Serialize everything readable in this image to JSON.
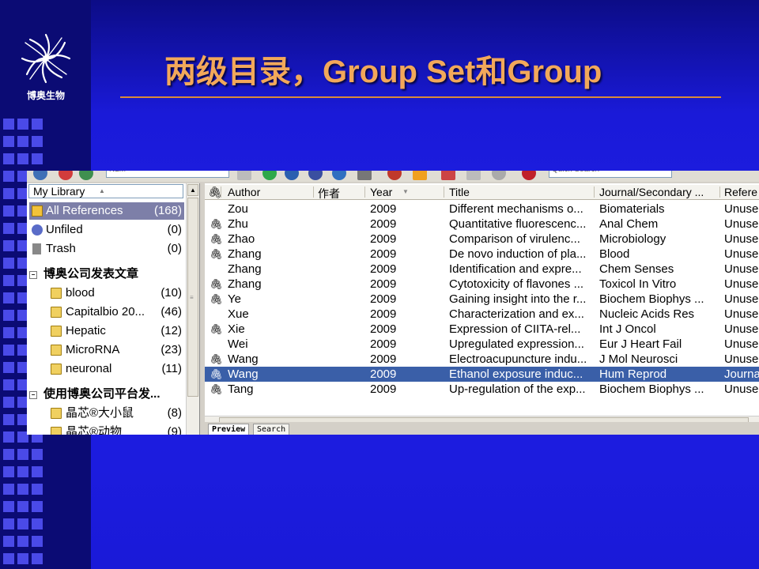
{
  "slide": {
    "title": "两级目录，Group Set和Group",
    "logo_text": "博奥生物",
    "colors": {
      "background": "#1f1fe8",
      "title": "#f2a85a",
      "rule": "#d98a3a"
    }
  },
  "toolbar": {
    "style_field": "NLM",
    "search_field": "Quick Search"
  },
  "library": {
    "header": "My Library",
    "items": [
      {
        "label": "All References",
        "count": "(168)",
        "icon": "references-icon",
        "selected": true
      },
      {
        "label": "Unfiled",
        "count": "(0)",
        "icon": "unfiled-icon"
      },
      {
        "label": "Trash",
        "count": "(0)",
        "icon": "trash-icon"
      }
    ],
    "group_sets": [
      {
        "label": "博奥公司发表文章",
        "groups": [
          {
            "label": "blood",
            "count": "(10)"
          },
          {
            "label": "Capitalbio 20...",
            "count": "(46)"
          },
          {
            "label": "Hepatic",
            "count": "(12)"
          },
          {
            "label": "MicroRNA",
            "count": "(23)"
          },
          {
            "label": "neuronal",
            "count": "(11)"
          }
        ]
      },
      {
        "label": "使用博奥公司平台发...",
        "groups": [
          {
            "label": "晶芯®大小鼠",
            "count": "(8)"
          },
          {
            "label": "晶芯®动物",
            "count": "(9)"
          }
        ]
      }
    ]
  },
  "references": {
    "columns": [
      "Author",
      "作者",
      "Year",
      "Title",
      "Journal/Secondary ...",
      "Refere"
    ],
    "rows": [
      {
        "clip": "",
        "author": "Zou",
        "year": "2009",
        "title": "Different mechanisms o...",
        "journal": "Biomaterials",
        "ref": "Unuse"
      },
      {
        "clip": "clip",
        "author": "Zhu",
        "year": "2009",
        "title": "Quantitative fluorescenc...",
        "journal": "Anal Chem",
        "ref": "Unuse"
      },
      {
        "clip": "clip",
        "author": "Zhao",
        "year": "2009",
        "title": "Comparison of virulenc...",
        "journal": "Microbiology",
        "ref": "Unuse"
      },
      {
        "clip": "clip",
        "author": "Zhang",
        "year": "2009",
        "title": "De novo induction of pla...",
        "journal": "Blood",
        "ref": "Unuse"
      },
      {
        "clip": "",
        "author": "Zhang",
        "year": "2009",
        "title": "Identification and expre...",
        "journal": "Chem Senses",
        "ref": "Unuse"
      },
      {
        "clip": "clip",
        "author": "Zhang",
        "year": "2009",
        "title": "Cytotoxicity of flavones ...",
        "journal": "Toxicol In Vitro",
        "ref": "Unuse"
      },
      {
        "clip": "clip",
        "author": "Ye",
        "year": "2009",
        "title": "Gaining insight into the r...",
        "journal": "Biochem Biophys ...",
        "ref": "Unuse"
      },
      {
        "clip": "",
        "author": "Xue",
        "year": "2009",
        "title": "Characterization and ex...",
        "journal": "Nucleic Acids Res",
        "ref": "Unuse"
      },
      {
        "clip": "clip",
        "author": "Xie",
        "year": "2009",
        "title": "Expression of CIITA-rel...",
        "journal": "Int J Oncol",
        "ref": "Unuse"
      },
      {
        "clip": "",
        "author": "Wei",
        "year": "2009",
        "title": "Upregulated expression...",
        "journal": "Eur J Heart Fail",
        "ref": "Unuse"
      },
      {
        "clip": "clip",
        "author": "Wang",
        "year": "2009",
        "title": "Electroacupuncture indu...",
        "journal": "J Mol Neurosci",
        "ref": "Unuse"
      },
      {
        "clip": "clip",
        "author": "Wang",
        "year": "2009",
        "title": "Ethanol exposure induc...",
        "journal": "Hum Reprod",
        "ref": "Journa",
        "selected": true
      },
      {
        "clip": "clip",
        "author": "Tang",
        "year": "2009",
        "title": "Up-regulation of the exp...",
        "journal": "Biochem Biophys ...",
        "ref": "Unuse"
      }
    ]
  },
  "bottom_tabs": [
    "Preview",
    "Search"
  ]
}
